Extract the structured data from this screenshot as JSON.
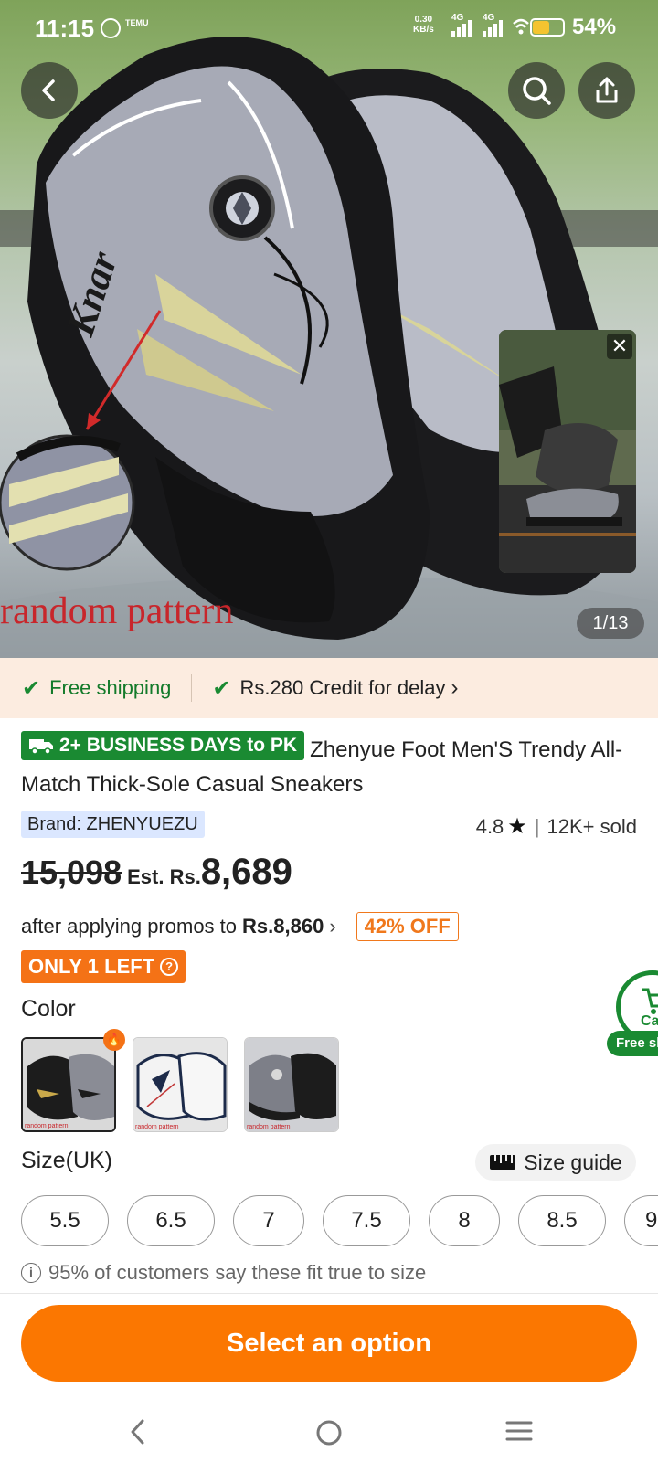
{
  "status_bar": {
    "time": "11:15",
    "app_label": "TEMU",
    "net_speed_value": "0.30",
    "net_speed_unit": "KB/s",
    "sim1_label": "4G",
    "sim2_label": "4G",
    "battery_percent": "54%",
    "battery_level": 0.54
  },
  "gallery": {
    "caption": "random pattern",
    "brand_on_shoe": "Knar",
    "counter": "1/13",
    "close_symbol": "✕"
  },
  "shipping_bar": {
    "free_shipping": "Free shipping",
    "credit": "Rs.280 Credit for delay",
    "credit_chevron": "›",
    "check_symbol": "✔"
  },
  "product": {
    "delivery_badge": "2+ BUSINESS DAYS to PK",
    "title": "Zhenyue Foot Men'S Trendy All-Match Thick-Sole Casual Sneakers",
    "brand": "Brand: ZHENYUEZU",
    "rating": "4.8",
    "rating_star": "★",
    "rating_separator": "|",
    "sold": "12K+ sold",
    "old_price": "15,098",
    "est_label": "Est. Rs.",
    "price": "8,689",
    "promo_text": "after applying promos to",
    "promo_price": "Rs.8,860",
    "promo_chevron": "›",
    "discount": "42% OFF",
    "stock": "ONLY 1 LEFT",
    "stock_help": "?"
  },
  "floating_cart": {
    "label": "Ca",
    "pill": "Free sh"
  },
  "color_section": {
    "label": "Color",
    "hot_symbol": "🔥",
    "swatches": [
      {
        "name": "black-gray",
        "caption": "random pattern",
        "colors": [
          "#1c1c1c",
          "#8a8c95",
          "#c9a84a"
        ],
        "selected": true
      },
      {
        "name": "white-navy",
        "caption": "random pattern",
        "colors": [
          "#f3f3f3",
          "#1d2b4a",
          "#c23a3a"
        ],
        "selected": false
      },
      {
        "name": "gray-black",
        "caption": "random pattern",
        "colors": [
          "#7d7f88",
          "#1c1c1c",
          "#d8d8d8"
        ],
        "selected": false
      }
    ]
  },
  "size_section": {
    "label": "Size(UK)",
    "guide": "Size guide",
    "sizes": [
      "5.5",
      "6.5",
      "7",
      "7.5",
      "8",
      "8.5",
      "9"
    ],
    "fit_icon": "i",
    "fit_note": "95% of customers say these fit true to size"
  },
  "cta": {
    "label": "Select an option",
    "color": "#fb7701"
  },
  "theme": {
    "accent": "#fb7701",
    "green": "#1a8a32",
    "discount_orange": "#f0781c"
  }
}
